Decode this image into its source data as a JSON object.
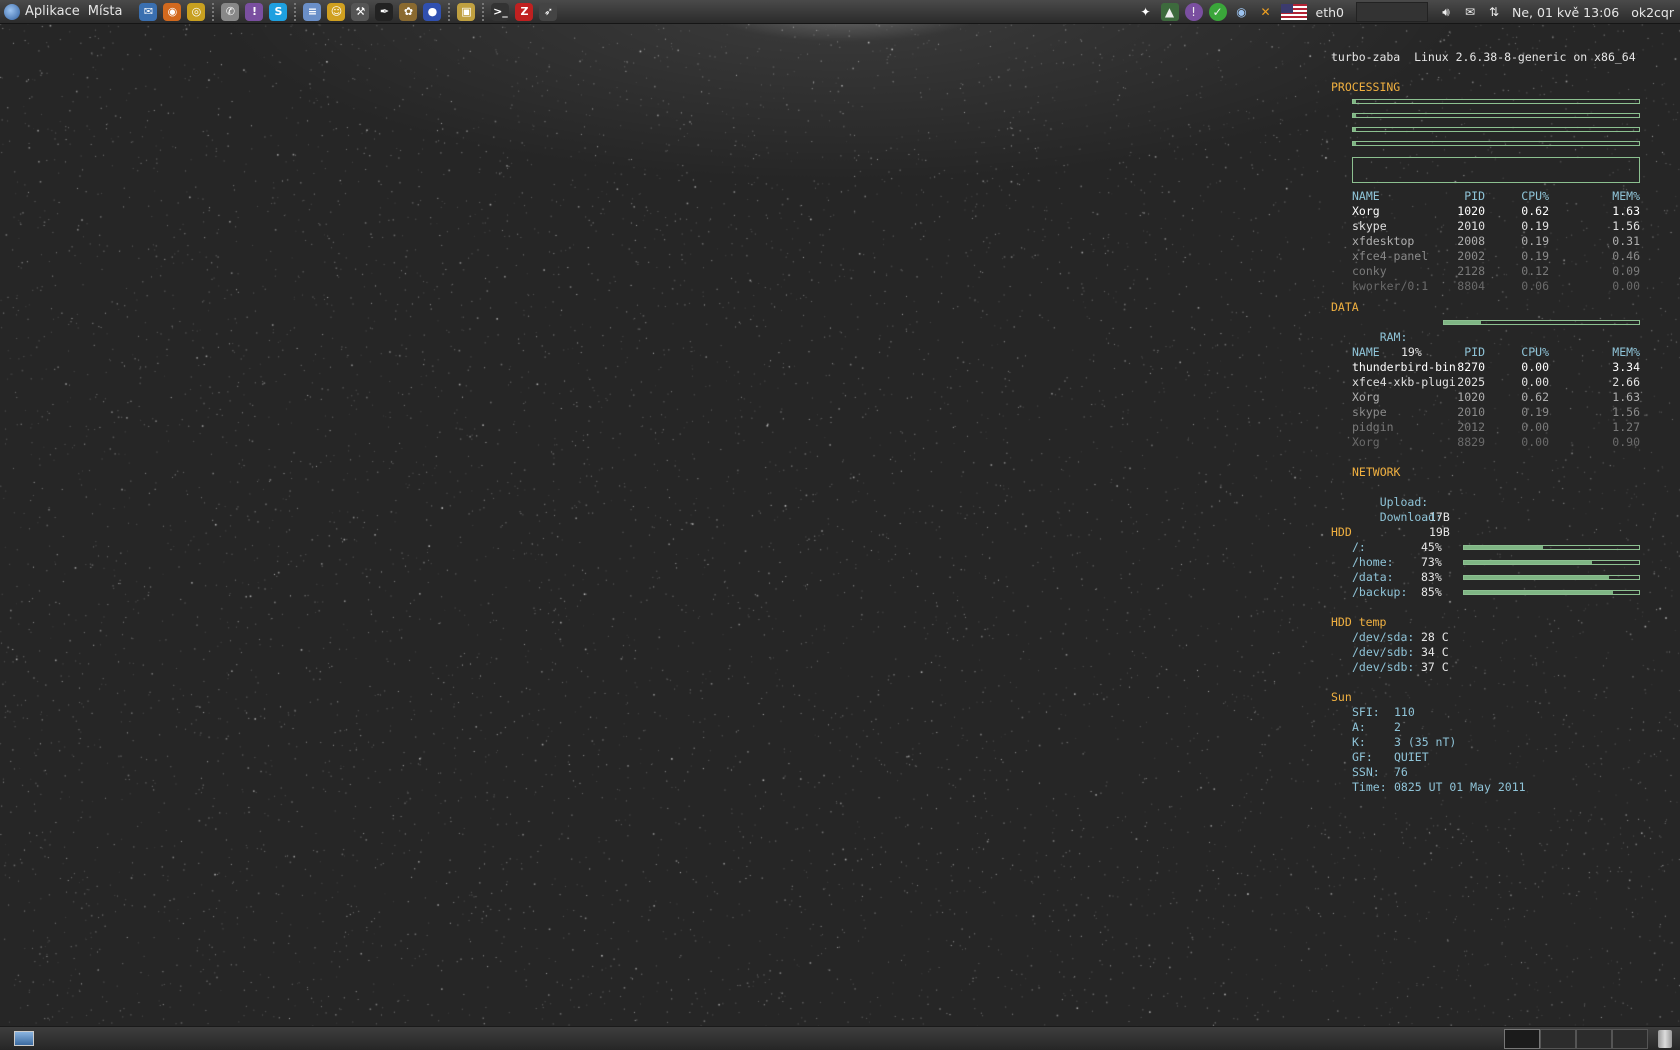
{
  "top_panel": {
    "menus": [
      "Aplikace",
      "Místa"
    ],
    "launchers": [
      {
        "icon": "thunderbird-icon",
        "glyph": "✉",
        "color": "#3a6fb0"
      },
      {
        "icon": "firefox-icon",
        "glyph": "◉",
        "color": "#d2691e"
      },
      {
        "icon": "chrome-icon",
        "glyph": "◎",
        "color": "#c8a020"
      },
      {
        "icon": "chat-icon",
        "glyph": "✆",
        "color": "#888888"
      },
      {
        "icon": "pidgin-icon",
        "glyph": "!",
        "color": "#7a4fa0"
      },
      {
        "icon": "skype-icon",
        "glyph": "S",
        "color": "#1ea0e0"
      },
      {
        "icon": "document-icon",
        "glyph": "≡",
        "color": "#6a8fc8"
      },
      {
        "icon": "pet-icon",
        "glyph": "☺",
        "color": "#d0a020"
      },
      {
        "icon": "tool-icon",
        "glyph": "⚒",
        "color": "#555555"
      },
      {
        "icon": "inkscape-icon",
        "glyph": "✒",
        "color": "#222222"
      },
      {
        "icon": "gimp-icon",
        "glyph": "✿",
        "color": "#8a6a30"
      },
      {
        "icon": "globe-icon",
        "glyph": "●",
        "color": "#3050b0"
      },
      {
        "icon": "image-viewer-icon",
        "glyph": "▣",
        "color": "#c0a040"
      },
      {
        "icon": "terminal-icon",
        "glyph": ">_",
        "color": "#333333"
      },
      {
        "icon": "filezilla-icon",
        "glyph": "Z",
        "color": "#c02020"
      },
      {
        "icon": "pointer-tool-icon",
        "glyph": "➶",
        "color": "#444444"
      }
    ],
    "tray": {
      "network_label": "eth0",
      "clock": "Ne, 01 kvě 13:06",
      "user": "ok2cqr"
    }
  },
  "conky": {
    "header": "turbo-zaba  Linux 2.6.38-8-generic on x86_64",
    "processing": {
      "title": "PROCESSING",
      "cpu_bars": [
        0.01,
        0.01,
        0.005,
        0.005
      ],
      "table_headers": {
        "name": "NAME",
        "pid": "PID",
        "cpu": "CPU%",
        "mem": "MEM%"
      },
      "rows": [
        {
          "name": "Xorg",
          "pid": "1020",
          "cpu": "0.62",
          "mem": "1.63",
          "color": "#ffffff"
        },
        {
          "name": "skype",
          "pid": "2010",
          "cpu": "0.19",
          "mem": "1.56",
          "color": "#e0e0e0"
        },
        {
          "name": "xfdesktop",
          "pid": "2008",
          "cpu": "0.19",
          "mem": "0.31",
          "color": "#b0b0b0"
        },
        {
          "name": "xfce4-panel",
          "pid": "2002",
          "cpu": "0.19",
          "mem": "0.46",
          "color": "#8a8a8a"
        },
        {
          "name": "conky",
          "pid": "2128",
          "cpu": "0.12",
          "mem": "0.09",
          "color": "#7a7a7a"
        },
        {
          "name": "kworker/0:1",
          "pid": "8804",
          "cpu": "0.06",
          "mem": "0.00",
          "color": "#6a6a6a"
        }
      ]
    },
    "data": {
      "title": "DATA",
      "ram_label": "RAM:",
      "ram_value": "19%",
      "ram_fraction": 0.19,
      "table_headers": {
        "name": "NAME",
        "pid": "PID",
        "cpu": "CPU%",
        "mem": "MEM%"
      },
      "rows": [
        {
          "name": "thunderbird-bin",
          "pid": "8270",
          "cpu": "0.00",
          "mem": "3.34",
          "color": "#ffffff"
        },
        {
          "name": "xfce4-xkb-plugi",
          "pid": "2025",
          "cpu": "0.00",
          "mem": "2.66",
          "color": "#e0e0e0"
        },
        {
          "name": "Xorg",
          "pid": "1020",
          "cpu": "0.62",
          "mem": "1.63",
          "color": "#b0b0b0"
        },
        {
          "name": "skype",
          "pid": "2010",
          "cpu": "0.19",
          "mem": "1.56",
          "color": "#8a8a8a"
        },
        {
          "name": "pidgin",
          "pid": "2012",
          "cpu": "0.00",
          "mem": "1.27",
          "color": "#7a7a7a"
        },
        {
          "name": "Xorg",
          "pid": "8829",
          "cpu": "0.00",
          "mem": "0.90",
          "color": "#6a6a6a"
        }
      ]
    },
    "network": {
      "title": "NETWORK",
      "upload_label": "Upload:",
      "upload_value": "17B",
      "download_label": "Download:",
      "download_value": "19B"
    },
    "hdd": {
      "title": "HDD",
      "disks": [
        {
          "mount": "/:",
          "percent": "45%",
          "fraction": 0.45
        },
        {
          "mount": "/home:",
          "percent": "73%",
          "fraction": 0.73
        },
        {
          "mount": "/data:",
          "percent": "83%",
          "fraction": 0.83
        },
        {
          "mount": "/backup:",
          "percent": "85%",
          "fraction": 0.85
        }
      ]
    },
    "hdd_temp": {
      "title": "HDD temp",
      "items": [
        {
          "device": "/dev/sda:",
          "value": "28 C"
        },
        {
          "device": "/dev/sdb:",
          "value": "34 C"
        },
        {
          "device": "/dev/sdb:",
          "value": "37 C"
        }
      ]
    },
    "sun": {
      "title": "Sun",
      "items": [
        {
          "label": "SFI:",
          "value": "110"
        },
        {
          "label": "A:",
          "value": "2"
        },
        {
          "label": "K:",
          "value": "3 (35 nT)"
        },
        {
          "label": "GF:",
          "value": "QUIET"
        },
        {
          "label": "SSN:",
          "value": "76"
        },
        {
          "label": "Time:",
          "value": "0825 UT 01 May 2011"
        }
      ]
    }
  },
  "colors": {
    "header_orange": "#f0b040",
    "label_cyan": "#8fc4d8",
    "bar_green": "#7fb584"
  }
}
